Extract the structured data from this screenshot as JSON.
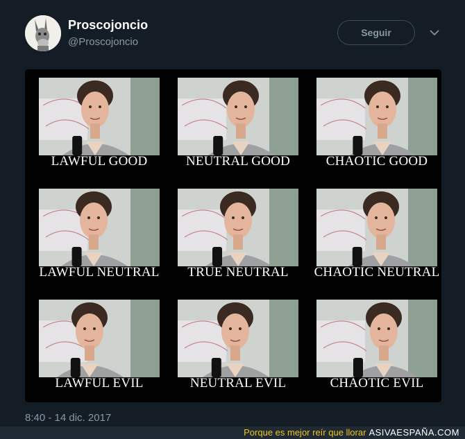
{
  "tweet": {
    "display_name": "Proscojoncio",
    "handle": "@Proscojoncio",
    "follow_label": "Seguir",
    "timestamp": "8:40 - 14 dic. 2017"
  },
  "meme": {
    "cells": [
      {
        "caption": "LAWFUL GOOD"
      },
      {
        "caption": "NEUTRAL GOOD"
      },
      {
        "caption": "CHAOTIC GOOD"
      },
      {
        "caption": "LAWFUL NEUTRAL"
      },
      {
        "caption": "TRUE NEUTRAL"
      },
      {
        "caption": "CHAOTIC NEUTRAL"
      },
      {
        "caption": "LAWFUL EVIL"
      },
      {
        "caption": "NEUTRAL EVIL"
      },
      {
        "caption": "CHAOTIC EVIL"
      }
    ]
  },
  "watermark": {
    "tagline": "Porque es mejor reír que llorar",
    "brand": "ASIVAESPAÑA.COM"
  },
  "colors": {
    "background": "#141d26",
    "secondary_text": "#8899a6",
    "media_background": "#020203",
    "watermark_tagline": "#f0c419"
  }
}
